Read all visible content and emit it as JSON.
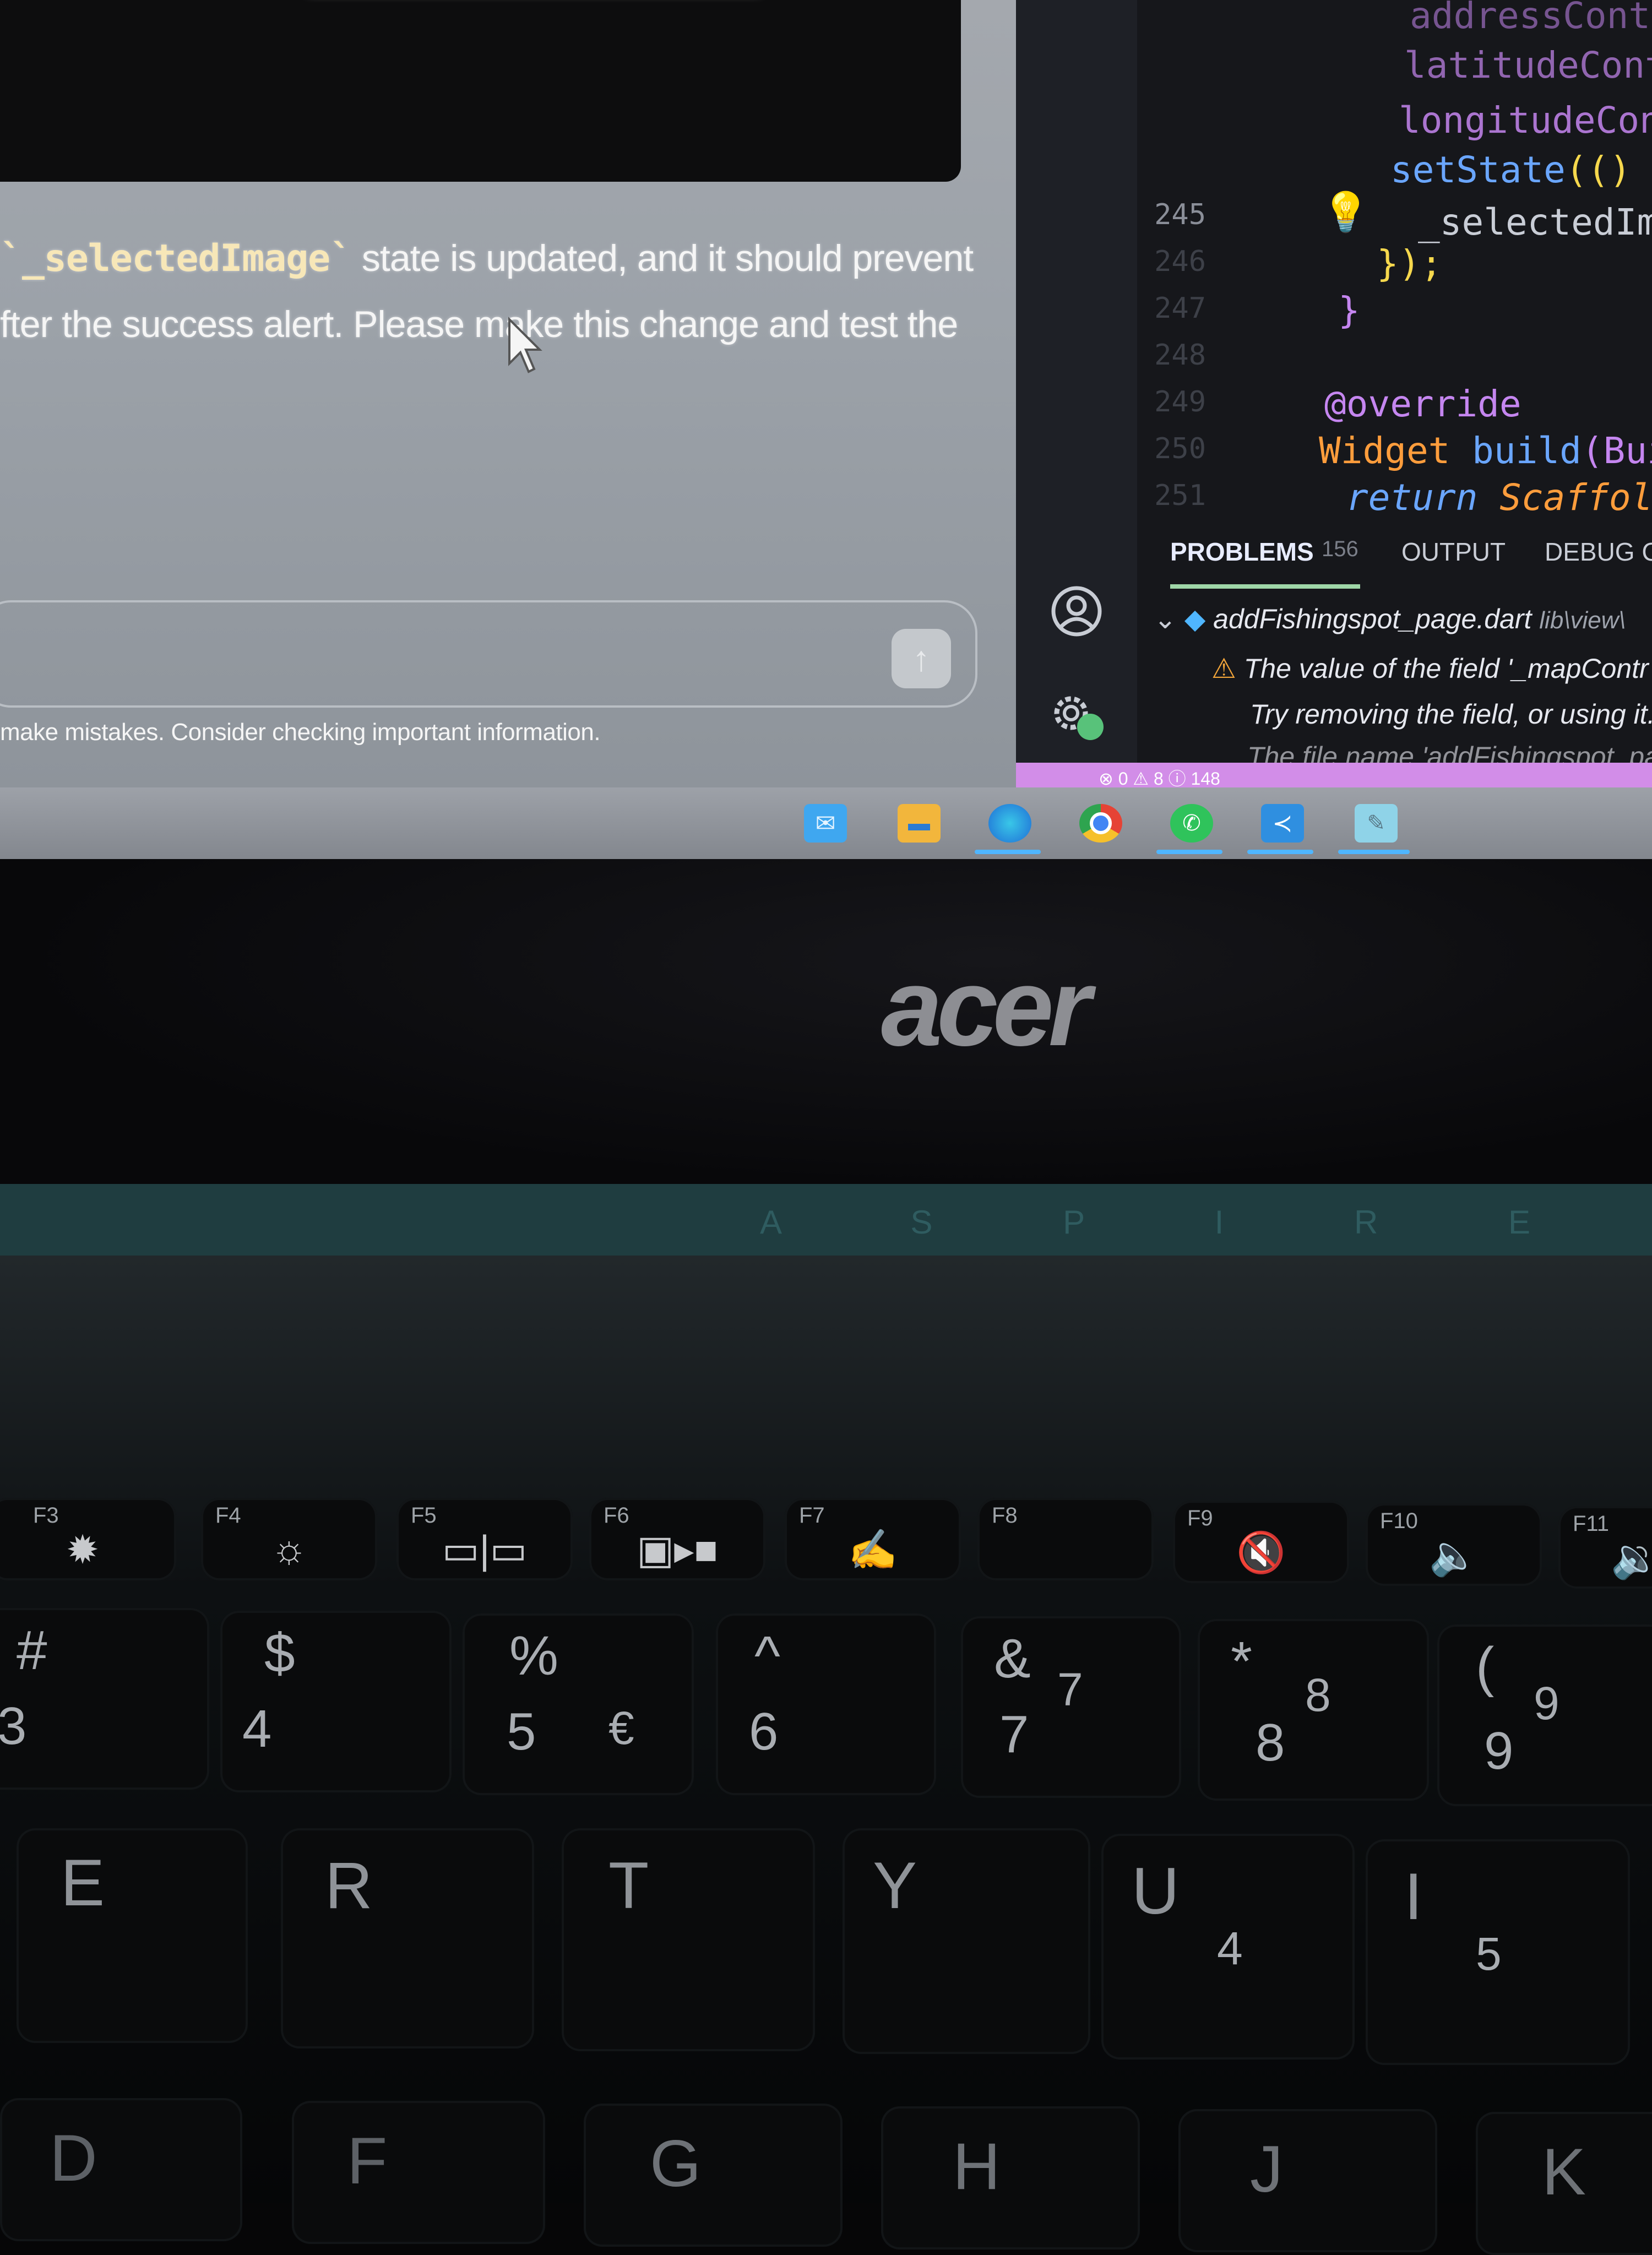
{
  "chat": {
    "line1_code": "`_selectedImage`",
    "line1_rest": " state is updated, and it should prevent",
    "line2": "fter the success alert. Please make this change and test the",
    "send_icon": "arrow-up-icon",
    "disclaimer": "make mistakes. Consider checking important information."
  },
  "editor": {
    "line_numbers": [
      "245",
      "246",
      "247",
      "248",
      "249",
      "250",
      "251"
    ],
    "code_lines": {
      "l1": "addressContro",
      "l2": "latitudeContro",
      "l3": "longitudeContro",
      "l4_fn": "setState",
      "l4_rest": "(() {",
      "l5": "_selectedImage",
      "l6": "});",
      "l7": "}",
      "l8": "@override",
      "l9_type": "Widget",
      "l9_fn": " build",
      "l9_arg": "(BuildCo",
      "l10_kw": "return",
      "l10_type": " Scaffold",
      "l10_rest": "("
    },
    "panel": {
      "tab_problems": "PROBLEMS",
      "problem_count": "156",
      "tab_output": "OUTPUT",
      "tab_debug": "DEBUG C",
      "file_name": "addFishingspot_page.dart",
      "file_path": "lib\\view\\",
      "warning_text": "The value of the field '_mapContr",
      "warning_hint": "Try removing the field, or using it.",
      "next_line": "The file name 'addFishingspot_pag"
    },
    "status_bar": "⊗ 0 ⚠ 8 ⓘ 148"
  },
  "taskbar": {
    "icons": [
      "mail-icon",
      "file-explorer-icon",
      "edge-icon",
      "chrome-icon",
      "whatsapp-icon",
      "vscode-icon",
      "notepad-icon"
    ]
  },
  "laptop": {
    "brand": "acer",
    "model": "A S P I R E"
  },
  "keyboard": {
    "fkeys": [
      {
        "label": "F3",
        "icon": "brightness-down-icon"
      },
      {
        "label": "F4",
        "icon": "brightness-up-icon"
      },
      {
        "label": "F5",
        "icon": "display-switch-icon"
      },
      {
        "label": "F6",
        "icon": "display-off-icon"
      },
      {
        "label": "F7",
        "icon": "touchpad-toggle-icon"
      },
      {
        "label": "F8",
        "icon": ""
      },
      {
        "label": "F9",
        "icon": "mute-icon"
      },
      {
        "label": "F10",
        "icon": "volume-down-icon"
      },
      {
        "label": "F11",
        "icon": "volume-up-icon"
      }
    ],
    "number_keys": [
      {
        "top": "#",
        "bottom": "3",
        "alt": ""
      },
      {
        "top": "$",
        "bottom": "4",
        "alt": ""
      },
      {
        "top": "%",
        "bottom": "5",
        "alt": "€"
      },
      {
        "top": "^",
        "bottom": "6",
        "alt": ""
      },
      {
        "top": "&",
        "bottom": "7",
        "alt": "7"
      },
      {
        "top": "*",
        "bottom": "8",
        "alt": "8"
      },
      {
        "top": "(",
        "bottom": "9",
        "alt": "9"
      }
    ],
    "letter_keys": [
      {
        "letter": "E",
        "alt": ""
      },
      {
        "letter": "R",
        "alt": ""
      },
      {
        "letter": "T",
        "alt": ""
      },
      {
        "letter": "Y",
        "alt": ""
      },
      {
        "letter": "U",
        "alt": "4"
      },
      {
        "letter": "I",
        "alt": "5"
      }
    ],
    "bottom_row": [
      "D",
      "F",
      "G",
      "H",
      "J",
      "K"
    ]
  }
}
